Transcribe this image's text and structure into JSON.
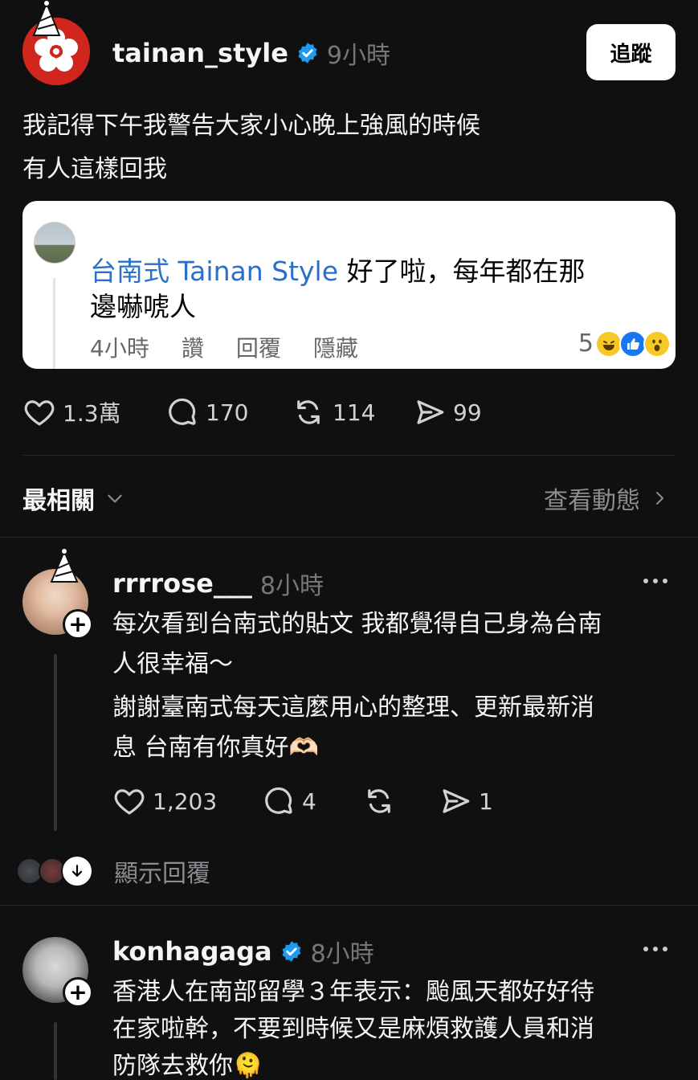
{
  "post": {
    "username": "tainan_style",
    "time": "9小時",
    "follow_label": "追蹤",
    "text_line1": "我記得下午我警告大家小心晚上強風的時候",
    "text_line2": "有人這樣回我",
    "embed": {
      "name": "台南式 Tainan Style",
      "text_part1": " 好了啦，每年都在那",
      "text_part2": "邊嚇唬人",
      "time": "4小時",
      "like": "讚",
      "reply": "回覆",
      "hide": "隱藏",
      "reaction_count": "5"
    },
    "stats": {
      "likes": "1.3萬",
      "comments": "170",
      "reposts": "114",
      "shares": "99"
    }
  },
  "sort": {
    "label": "最相關",
    "activity_label": "查看動態"
  },
  "comments": [
    {
      "username": "rrrrose___",
      "time": "8小時",
      "line1": "每次看到台南式的貼文 我都覺得自己身為台南",
      "line2": "人很幸福～",
      "line3": "謝謝臺南式每天這麼用心的整理、更新最新消",
      "line4": "息 台南有你真好🫶🏻",
      "likes": "1,203",
      "comments": "4",
      "shares": "1",
      "show_replies": "顯示回覆"
    },
    {
      "username": "konhagaga",
      "time": "8小時",
      "line1": "香港人在南部留學３年表示：颱風天都好好待",
      "line2": "在家啦幹，不要到時候又是麻煩救護人員和消",
      "line3": "防隊去救你🫠"
    }
  ],
  "colors": {
    "accent_blue": "#1d9bf0",
    "facebook_blue": "#2a6fc9",
    "brand_red": "#d0261d"
  }
}
